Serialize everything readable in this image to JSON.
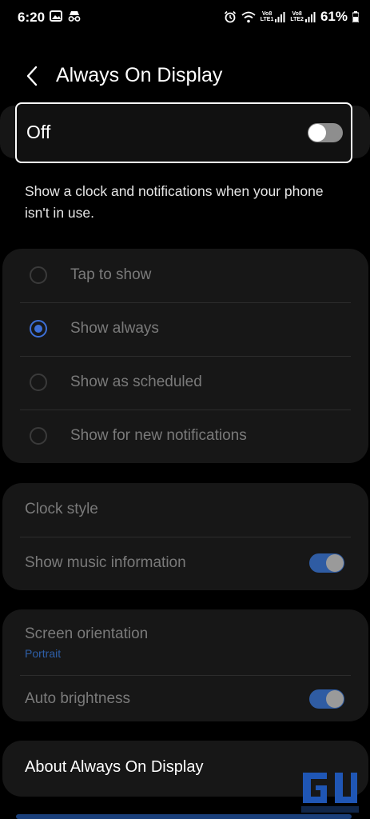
{
  "status_bar": {
    "time": "6:20",
    "net_label_1": "Vo8\nLTE1",
    "net_label_2": "Vo8\nLTE2",
    "battery": "61%"
  },
  "header": {
    "title": "Always On Display"
  },
  "master": {
    "label": "Off",
    "enabled": false
  },
  "description": "Show a clock and notifications when your phone isn't in use.",
  "modes": [
    {
      "label": "Tap to show",
      "selected": false
    },
    {
      "label": "Show always",
      "selected": true
    },
    {
      "label": "Show as scheduled",
      "selected": false
    },
    {
      "label": "Show for new notifications",
      "selected": false
    }
  ],
  "clock": {
    "style_label": "Clock style",
    "music_label": "Show music information",
    "music_on": true
  },
  "orientation": {
    "label": "Screen orientation",
    "value": "Portrait",
    "brightness_label": "Auto brightness",
    "brightness_on": true
  },
  "about": {
    "label": "About Always On Display"
  },
  "colors": {
    "accent": "#3d6fd6",
    "card": "#171717",
    "background": "#000000"
  }
}
